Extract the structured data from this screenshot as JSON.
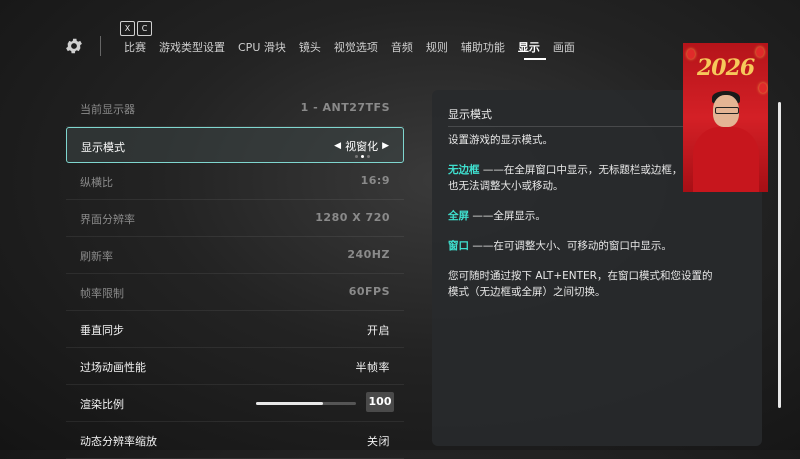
{
  "keyhints": [
    "X",
    "C"
  ],
  "nav": {
    "tabs": [
      "比赛",
      "游戏类型设置",
      "CPU 滑块",
      "镜头",
      "视觉选项",
      "音频",
      "规则",
      "辅助功能",
      "显示",
      "画面"
    ],
    "active": "显示"
  },
  "settings": {
    "monitor": {
      "label": "当前显示器",
      "value": "1 - ANT27TFS"
    },
    "display_mode": {
      "label": "显示模式",
      "value": "视窗化",
      "prev": "◀",
      "next": "▶"
    },
    "aspect": {
      "label": "纵横比",
      "value": "16:9"
    },
    "resolution": {
      "label": "界面分辨率",
      "value": "1280 X 720"
    },
    "refresh": {
      "label": "刷新率",
      "value": "240HZ"
    },
    "framerate": {
      "label": "帧率限制",
      "value": "60FPS"
    },
    "vsync": {
      "label": "垂直同步",
      "value": "开启"
    },
    "cutscene": {
      "label": "过场动画性能",
      "value": "半帧率"
    },
    "render_scale": {
      "label": "渲染比例",
      "value": "100",
      "fill_fraction": 0.67
    },
    "dynamic_res": {
      "label": "动态分辨率缩放",
      "value": "关闭"
    }
  },
  "info_panel": {
    "title": "显示模式",
    "desc": "设置游戏的显示模式。",
    "borderless_key": "无边框",
    "borderless_text": " ——在全屏窗口中显示，无标题栏或边框，也无法调整大小或移动。",
    "fullscreen_key": "全屏",
    "fullscreen_text": " ——全屏显示。",
    "window_key": "窗口",
    "window_text": " ——在可调整大小、可移动的窗口中显示。",
    "tip": "您可随时通过按下 ALT+ENTER，在窗口模式和您设置的模式（无边框或全屏）之间切换。"
  },
  "overlay": {
    "year": "2026"
  },
  "colors": {
    "accent": "#3fe0cf",
    "selected_border": "#7fd6cf"
  }
}
